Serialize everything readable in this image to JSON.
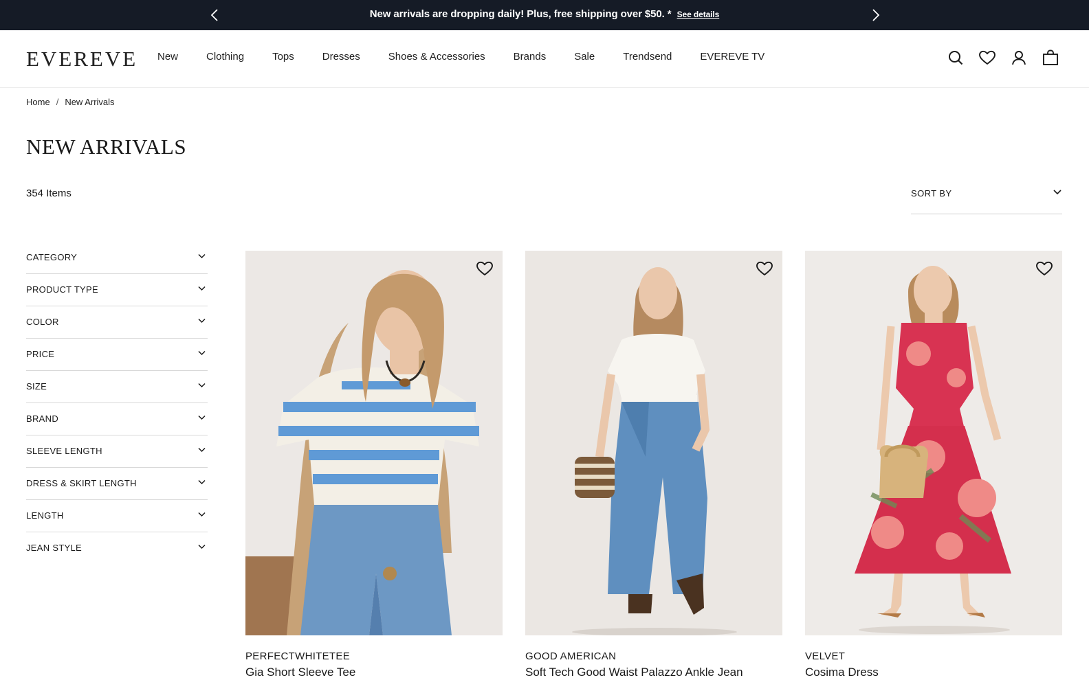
{
  "promo": {
    "text": "New arrivals are dropping daily! Plus, free shipping over $50. *",
    "link": "See details"
  },
  "header": {
    "logo": "EVEREVE",
    "nav": [
      "New",
      "Clothing",
      "Tops",
      "Dresses",
      "Shoes & Accessories",
      "Brands",
      "Sale",
      "Trendsend",
      "EVEREVE TV"
    ],
    "icons": [
      "search-icon",
      "heart-icon",
      "account-icon",
      "bag-icon"
    ]
  },
  "breadcrumb": {
    "home": "Home",
    "sep": "/",
    "current": "New Arrivals"
  },
  "page": {
    "title": "NEW ARRIVALS",
    "count": "354 Items",
    "sort_label": "SORT BY"
  },
  "filters": [
    "CATEGORY",
    "PRODUCT TYPE",
    "COLOR",
    "PRICE",
    "SIZE",
    "BRAND",
    "SLEEVE LENGTH",
    "DRESS & SKIRT LENGTH",
    "LENGTH",
    "JEAN STYLE"
  ],
  "products": [
    {
      "brand": "PERFECTWHITETEE",
      "name": "Gia Short Sleeve Tee"
    },
    {
      "brand": "GOOD AMERICAN",
      "name": "Soft Tech Good Waist Palazzo Ankle Jean"
    },
    {
      "brand": "VELVET",
      "name": "Cosima Dress"
    }
  ],
  "colors": {
    "promo_bg": "#151b26",
    "text": "#1a1a1a",
    "divider": "#d8d8d8"
  }
}
